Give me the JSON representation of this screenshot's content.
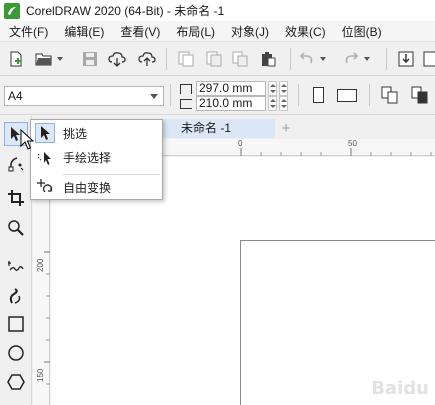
{
  "window": {
    "title": "CorelDRAW 2020 (64-Bit) - 未命名 -1"
  },
  "menu": [
    "文件(F)",
    "编辑(E)",
    "查看(V)",
    "布局(L)",
    "对象(J)",
    "效果(C)",
    "位图(B)"
  ],
  "toolbar": {
    "icons": [
      "new-document-icon",
      "open-folder-icon",
      "save-icon",
      "cloud-download-icon",
      "cloud-upload-icon",
      "copy-page-icon",
      "copy-icon",
      "paste-icon",
      "undo-icon",
      "redo-icon",
      "import-icon"
    ]
  },
  "properties": {
    "page_size": "A4",
    "width": "297.0 mm",
    "height": "210.0 mm"
  },
  "tools": [
    "pick-tool-icon",
    "shape-tool-icon",
    "crop-tool-icon",
    "zoom-tool-icon",
    "freehand-tool-icon",
    "artistic-media-icon",
    "rectangle-tool-icon",
    "ellipse-tool-icon",
    "polygon-tool-icon"
  ],
  "document": {
    "tab_label": "未命名 -1",
    "add_tab": "+"
  },
  "rulers": {
    "h_labels": [
      "0",
      "50"
    ],
    "v_labels": [
      "200",
      "150"
    ]
  },
  "flyout": {
    "items": [
      {
        "label": "挑选",
        "icon": "pick-arrow-icon",
        "selected": true
      },
      {
        "label": "手绘选择",
        "icon": "freehand-pick-icon",
        "selected": false
      },
      {
        "label": "自由变换",
        "icon": "free-transform-icon",
        "selected": false
      }
    ]
  },
  "watermark": {
    "text": "Baidu"
  },
  "colors": {
    "accent": "#dce8f6",
    "accent_border": "#8db2e3",
    "logo_green": "#3a9b35"
  }
}
